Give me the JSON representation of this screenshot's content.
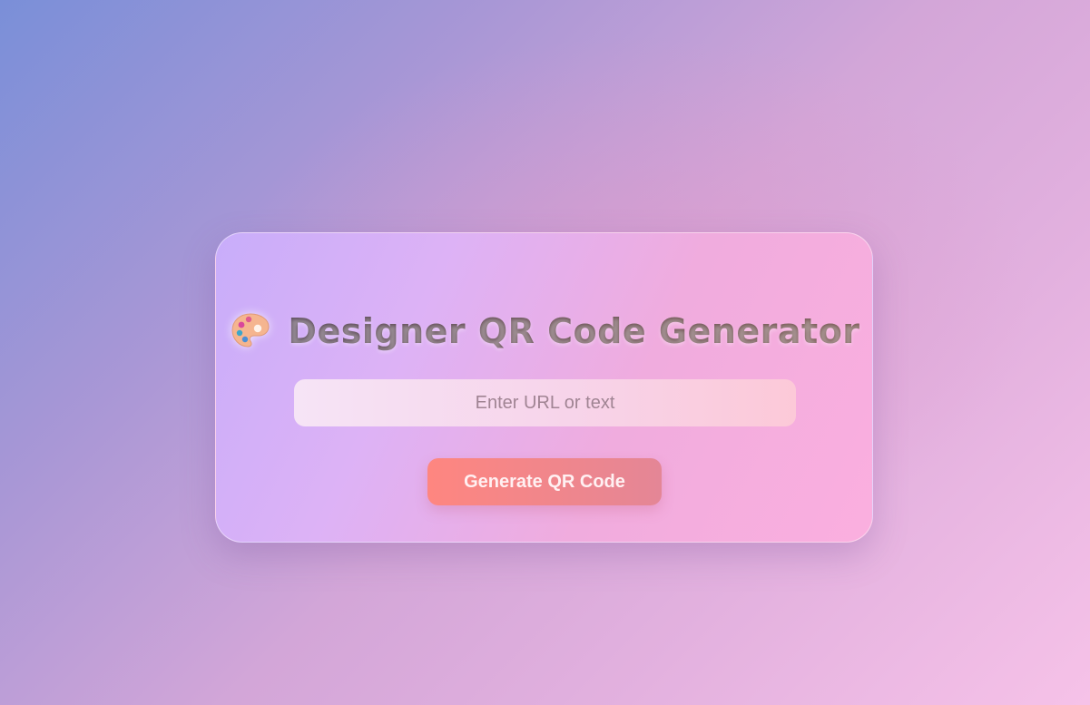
{
  "header": {
    "icon": "palette-icon",
    "title": "Designer QR Code Generator"
  },
  "form": {
    "input_value": "",
    "input_placeholder": "Enter URL or text",
    "generate_label": "Generate QR Code"
  },
  "colors": {
    "card_start": "#c8adfa",
    "card_end": "#fbafdf",
    "button_start": "#fe8680",
    "button_end": "#e48696",
    "title_text": "#5a4a5a"
  }
}
